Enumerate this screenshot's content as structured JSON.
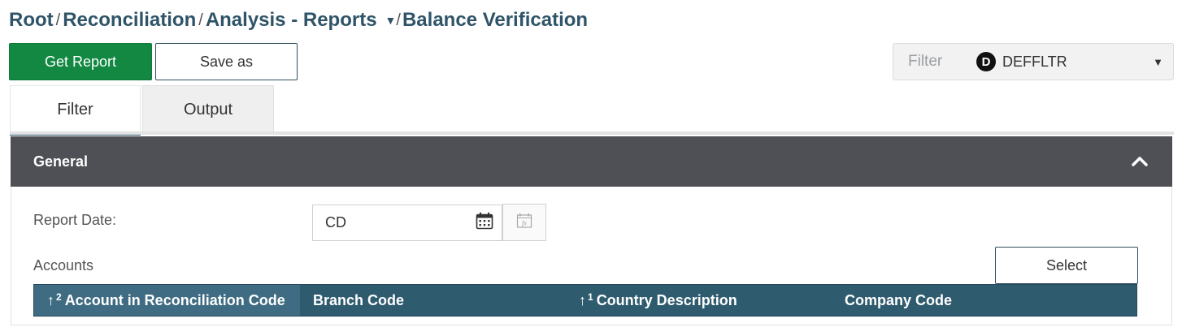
{
  "breadcrumb": {
    "items": [
      "Root",
      "Reconciliation",
      "Analysis - Reports",
      "Balance Verification"
    ],
    "separator": "/"
  },
  "toolbar": {
    "get_report_label": "Get Report",
    "save_as_label": "Save as"
  },
  "filter_selector": {
    "label": "Filter",
    "badge": "D",
    "value": "DEFFLTR"
  },
  "tabs": [
    {
      "label": "Filter",
      "active": true
    },
    {
      "label": "Output",
      "active": false
    }
  ],
  "section": {
    "title": "General"
  },
  "form": {
    "report_date_label": "Report Date:",
    "report_date_value": "CD",
    "accounts_label": "Accounts",
    "select_label": "Select"
  },
  "grid": {
    "columns": [
      {
        "label": "Account in Reconciliation Code",
        "sort_order": "2",
        "sort": "asc"
      },
      {
        "label": "Branch Code",
        "sort_order": "",
        "sort": ""
      },
      {
        "label": "Country Description",
        "sort_order": "1",
        "sort": "asc"
      },
      {
        "label": "Company Code",
        "sort_order": "",
        "sort": ""
      }
    ]
  },
  "colors": {
    "primary_button": "#128842",
    "breadcrumb": "#2f5468",
    "section_header": "#4f5055",
    "grid_header": "#2f5b6f"
  },
  "icons": [
    "chevron-down-icon",
    "chevron-up-icon",
    "calendar-icon",
    "function-icon",
    "sort-ascending-icon"
  ]
}
